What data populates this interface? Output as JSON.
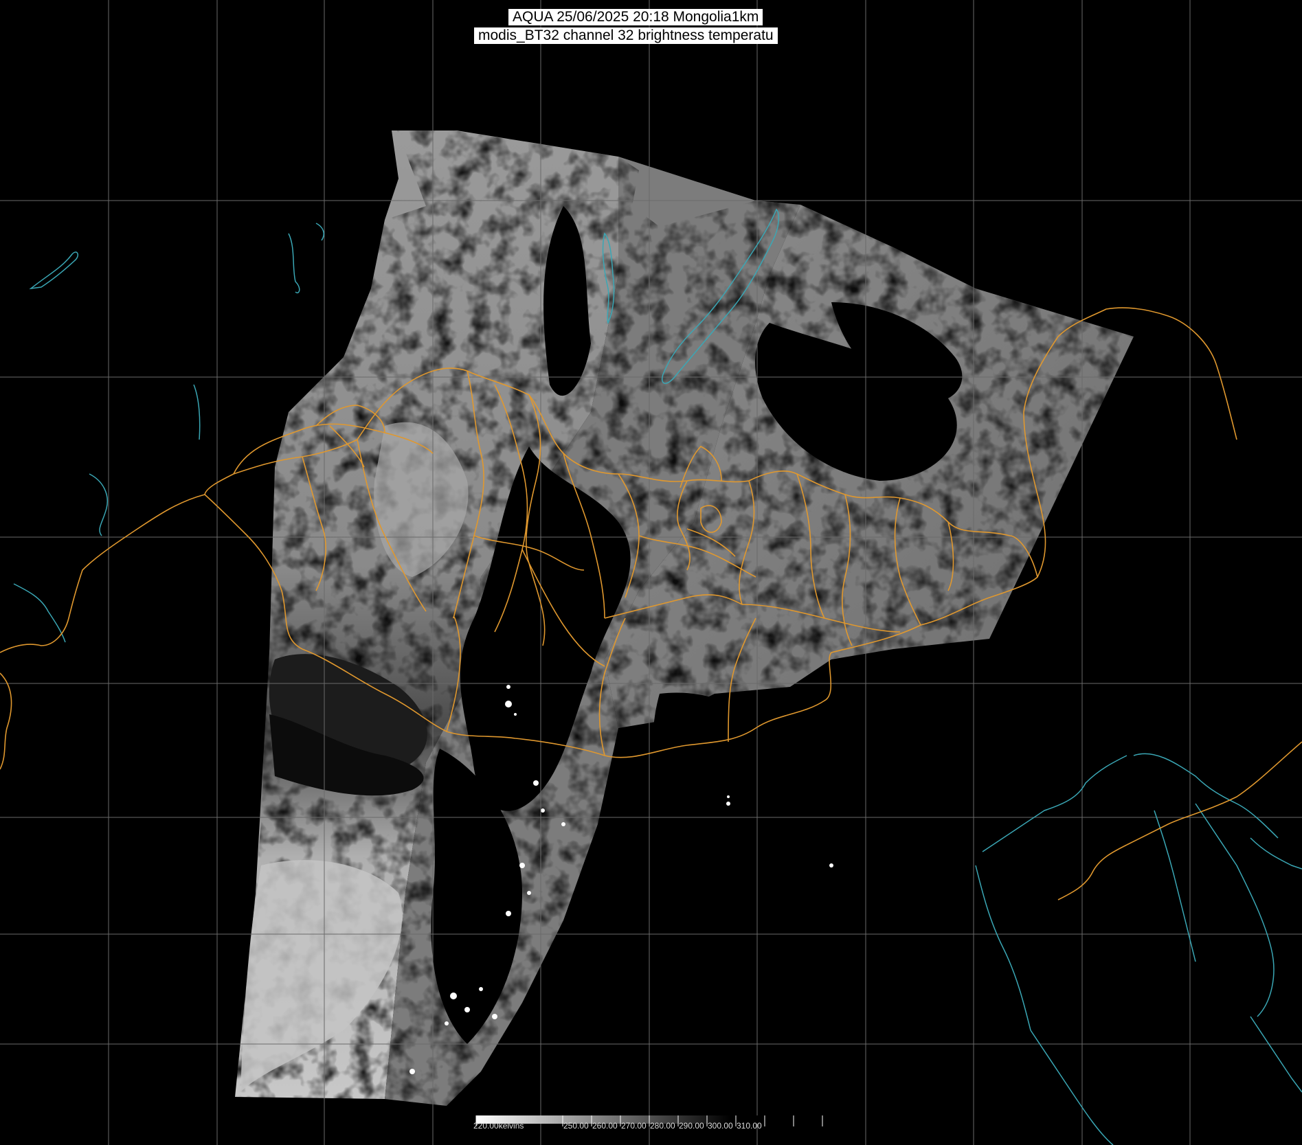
{
  "header": {
    "line1": "AQUA 25/06/2025 20:18 Mongolia1km",
    "line2": "modis_BT32 channel 32 brightness temperatu"
  },
  "legend": {
    "unit": "kelvins",
    "labels": [
      "220.00kelvins",
      "250.00",
      "260.00",
      "270.00",
      "280.00",
      "290.00",
      "300.00",
      "310.00"
    ]
  },
  "colors": {
    "background": "#000000",
    "grid": "#6a6a6a",
    "borders": "#e0982e",
    "coast": "#3aa7b5",
    "imagery_light": "#bdbdbd",
    "imagery_dark": "#1a1a1a"
  },
  "map_layers": [
    "lat-lon-grid",
    "satellite-swath",
    "admin-borders",
    "coastlines",
    "lakes",
    "rivers"
  ]
}
